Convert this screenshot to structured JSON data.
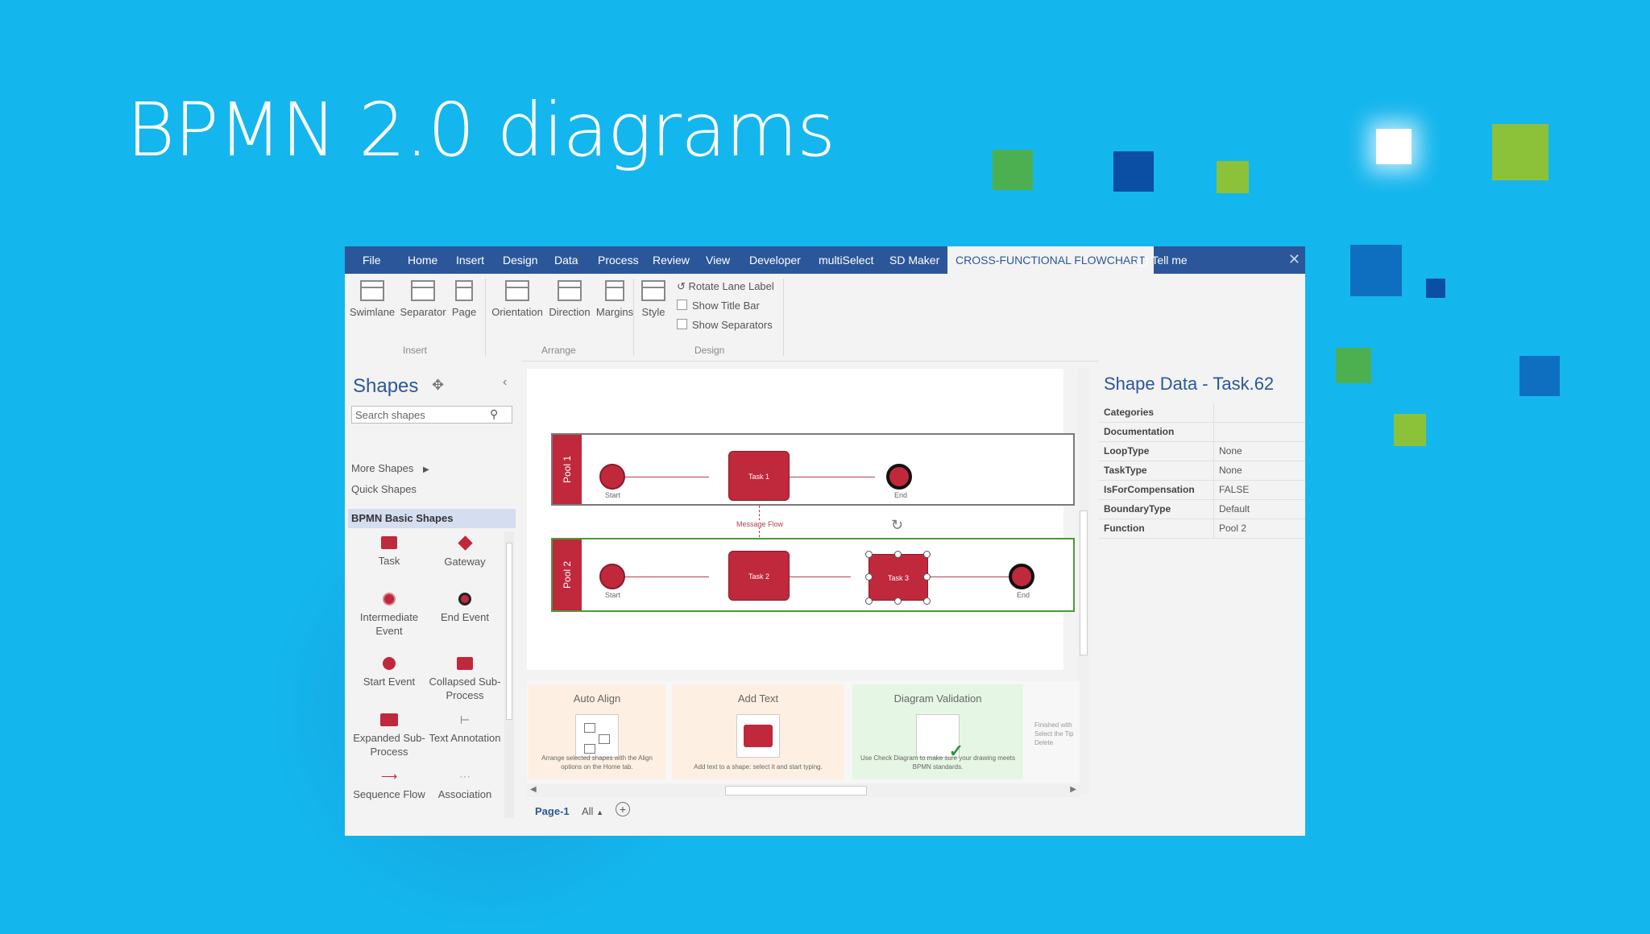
{
  "slide": {
    "title": "BPMN 2.0 diagrams"
  },
  "app": {
    "tabs": [
      "File",
      "Home",
      "Insert",
      "Design",
      "Data",
      "Process",
      "Review",
      "View",
      "Developer",
      "multiSelect",
      "SD Maker",
      "CROSS-FUNCTIONAL FLOWCHART"
    ],
    "tell_me": "Tell me",
    "ribbon": {
      "insert": {
        "swimlane": "Swimlane",
        "separator": "Separator",
        "page": "Page",
        "group": "Insert"
      },
      "arrange": {
        "orientation": "Orientation",
        "direction": "Direction",
        "margins": "Margins",
        "group": "Arrange"
      },
      "design": {
        "style": "Style",
        "rotate_lane_label": "Rotate Lane Label",
        "show_title_bar": "Show Title Bar",
        "show_separators": "Show Separators",
        "group": "Design"
      }
    },
    "shapes_panel": {
      "title": "Shapes",
      "search_placeholder": "Search shapes",
      "more_shapes": "More Shapes",
      "quick_shapes": "Quick Shapes",
      "selected_stencil": "BPMN Basic Shapes",
      "items": [
        {
          "label": "Task",
          "icon": "task-icon"
        },
        {
          "label": "Gateway",
          "icon": "gateway-icon"
        },
        {
          "label": "Intermediate Event",
          "icon": "intermediate-event-icon"
        },
        {
          "label": "End Event",
          "icon": "end-event-icon"
        },
        {
          "label": "Start Event",
          "icon": "start-event-icon"
        },
        {
          "label": "Collapsed Sub-Process",
          "icon": "collapsed-subprocess-icon"
        },
        {
          "label": "Expanded Sub-Process",
          "icon": "expanded-subprocess-icon"
        },
        {
          "label": "Text Annotation",
          "icon": "text-annotation-icon"
        },
        {
          "label": "Sequence Flow",
          "icon": "sequence-flow-icon"
        },
        {
          "label": "Association",
          "icon": "association-icon"
        }
      ]
    },
    "diagram": {
      "pool1": {
        "label": "Pool 1",
        "start": "Start",
        "task": "Task 1",
        "end": "End"
      },
      "pool2": {
        "label": "Pool 2",
        "start": "Start",
        "task": "Task 2",
        "task_selected": "Task 3",
        "end": "End"
      },
      "message_flow": "Message Flow"
    },
    "tips": [
      {
        "title": "Auto Align",
        "desc": "Arrange selected shapes with the Align options on the Home tab."
      },
      {
        "title": "Add Text",
        "desc": "Add text to a shape: select it and start typing."
      },
      {
        "title": "Diagram Validation",
        "desc": "Use Check Diagram to make sure your drawing meets BPMN standards."
      },
      {
        "title": "",
        "desc": "Finished with Select the Tip Delete"
      }
    ],
    "page_tabs": {
      "current": "Page-1",
      "all": "All"
    },
    "shape_data": {
      "title": "Shape Data - Task.62",
      "rows": [
        {
          "key": "Categories",
          "value": ""
        },
        {
          "key": "Documentation",
          "value": ""
        },
        {
          "key": "LoopType",
          "value": "None"
        },
        {
          "key": "TaskType",
          "value": "None"
        },
        {
          "key": "IsForCompensation",
          "value": "FALSE"
        },
        {
          "key": "BoundaryType",
          "value": "Default"
        },
        {
          "key": "Function",
          "value": "Pool 2"
        }
      ]
    }
  },
  "colors": {
    "background": "#14b6ee",
    "ribbon": "#2b579a",
    "bpmn_red": "#c0283c"
  }
}
